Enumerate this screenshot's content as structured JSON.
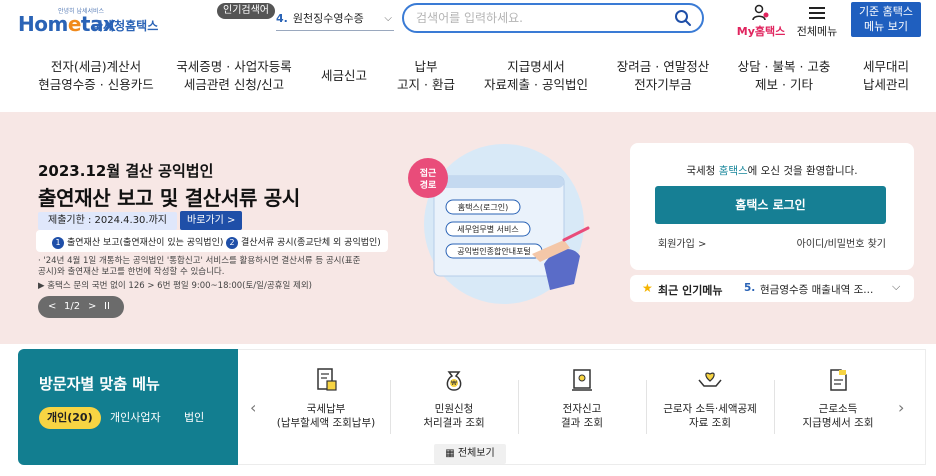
{
  "header": {
    "logo_tagline": "안녕히 납세서비스",
    "logo_mark": "Hometax",
    "logo_name": "국세청홈택스",
    "popular_badge": "인기검색어",
    "popular_num": "4.",
    "popular_text": "원천징수영수증",
    "search_placeholder": "검색어를 입력하세요.",
    "my_hometax": "My홈택스",
    "all_menu": "전체메뉴",
    "legacy_line1": "기준 홈택스",
    "legacy_line2": "메뉴 보기"
  },
  "nav": [
    {
      "l1": "전자(세금)계산서",
      "l2": "현금영수증 · 신용카드"
    },
    {
      "l1": "국세증명 · 사업자등록",
      "l2": "세금관련 신청/신고"
    },
    {
      "l1": "세금신고",
      "l2": ""
    },
    {
      "l1": "납부",
      "l2": "고지 · 환급"
    },
    {
      "l1": "지급명세서",
      "l2": "자료제출 · 공익법인"
    },
    {
      "l1": "장려금 · 연말정산",
      "l2": "전자기부금"
    },
    {
      "l1": "상담 · 불복 · 고충",
      "l2": "제보 · 기타"
    },
    {
      "l1": "세무대리",
      "l2": "납세관리"
    }
  ],
  "hero": {
    "subtitle": "2023.12월 결산 공익법인",
    "title": "출연재산 보고 및 결산서류 공시",
    "deadline": "제출기한 : 2024.4.30.까지",
    "goto": "바로가기 >",
    "item1_num": "1",
    "item1": "출연재산 보고(출연재산이 있는 공익법인)",
    "item2_num": "2",
    "item2": "결산서류 공시(종교단체 외 공익법인)",
    "note": "· '24년 4월 1일 개통하는 공익법인 '통합신고' 서비스를 활용하시면 결산서류 등 공시(표준공시)와 출연재산 보고를 한번에 작성할 수 있습니다.",
    "note2": "▶ 홈택스 문의 국번 없이 126 > 6번 평일 9:00~18:00(토/일/공휴일 제외)",
    "pager_prev": "<",
    "pager_text": "1/2",
    "pager_next": ">",
    "pager_pause": "II",
    "illus_badge_1": "접근",
    "illus_badge_2": "경로",
    "illus_step1": "홈택스(로그인)",
    "illus_step2": "세무업무별 서비스",
    "illus_step3": "공익법인종합안내포털"
  },
  "login": {
    "welcome_pre": "국세청 ",
    "welcome_hl": "홈택스",
    "welcome_post": "에 오신 것을 환영합니다.",
    "button": "홈택스 로그인",
    "signup": "회원가입 >",
    "find": "아이디/비밀번호 찾기"
  },
  "popular": {
    "title": "최근 인기메뉴",
    "num": "5.",
    "text": "현금영수증 매출내역 조..."
  },
  "visitor": {
    "title": "방문자별 맞춤 메뉴",
    "tab_personal": "개인(20)",
    "tab_biz": "개인사업자",
    "tab_corp": "법인"
  },
  "services": [
    {
      "l1": "국세납부",
      "l2": "(납부할세액 조회납부)",
      "icon": "tax-payment-icon"
    },
    {
      "l1": "민원신청",
      "l2": "처리결과 조회",
      "icon": "money-bag-icon"
    },
    {
      "l1": "전자신고",
      "l2": "결과 조회",
      "icon": "e-filing-icon"
    },
    {
      "l1": "근로자 소득·세액공제",
      "l2": "자료 조회",
      "icon": "heart-hands-icon"
    },
    {
      "l1": "근로소득",
      "l2": "지급명세서 조회",
      "icon": "document-icon"
    }
  ],
  "all_view": "전체보기",
  "colors": {
    "brand_blue": "#2a63b6",
    "teal": "#127e90",
    "hero_bg": "#f7e7e5",
    "accent_yellow": "#f7d443"
  }
}
